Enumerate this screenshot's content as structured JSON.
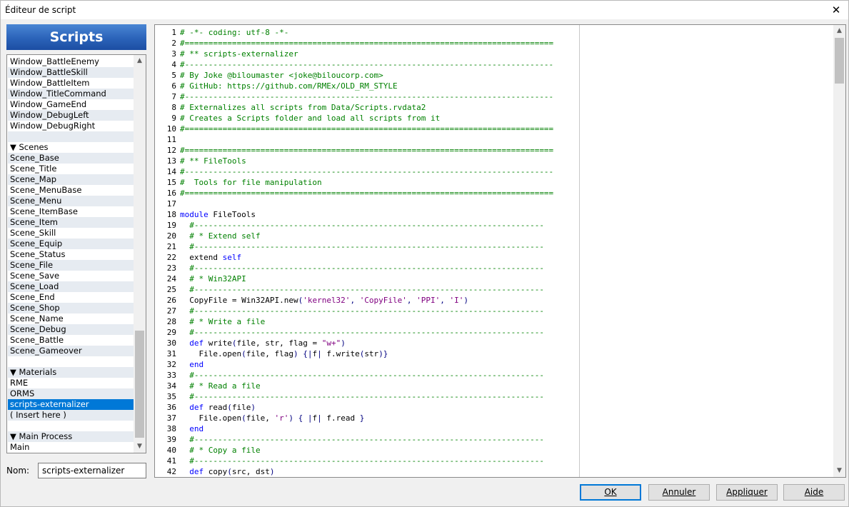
{
  "window": {
    "title": "Éditeur de script",
    "close_glyph": "✕"
  },
  "sidebar": {
    "header": "Scripts",
    "items": [
      {
        "label": "Window_BattleEnemy",
        "type": "item"
      },
      {
        "label": "Window_BattleSkill",
        "type": "item"
      },
      {
        "label": "Window_BattleItem",
        "type": "item"
      },
      {
        "label": "Window_TitleCommand",
        "type": "item"
      },
      {
        "label": "Window_GameEnd",
        "type": "item"
      },
      {
        "label": "Window_DebugLeft",
        "type": "item"
      },
      {
        "label": "Window_DebugRight",
        "type": "item"
      },
      {
        "label": "",
        "type": "blank"
      },
      {
        "label": "▼ Scenes",
        "type": "category"
      },
      {
        "label": "Scene_Base",
        "type": "item"
      },
      {
        "label": "Scene_Title",
        "type": "item"
      },
      {
        "label": "Scene_Map",
        "type": "item"
      },
      {
        "label": "Scene_MenuBase",
        "type": "item"
      },
      {
        "label": "Scene_Menu",
        "type": "item"
      },
      {
        "label": "Scene_ItemBase",
        "type": "item"
      },
      {
        "label": "Scene_Item",
        "type": "item"
      },
      {
        "label": "Scene_Skill",
        "type": "item"
      },
      {
        "label": "Scene_Equip",
        "type": "item"
      },
      {
        "label": "Scene_Status",
        "type": "item"
      },
      {
        "label": "Scene_File",
        "type": "item"
      },
      {
        "label": "Scene_Save",
        "type": "item"
      },
      {
        "label": "Scene_Load",
        "type": "item"
      },
      {
        "label": "Scene_End",
        "type": "item"
      },
      {
        "label": "Scene_Shop",
        "type": "item"
      },
      {
        "label": "Scene_Name",
        "type": "item"
      },
      {
        "label": "Scene_Debug",
        "type": "item"
      },
      {
        "label": "Scene_Battle",
        "type": "item"
      },
      {
        "label": "Scene_Gameover",
        "type": "item"
      },
      {
        "label": "",
        "type": "blank"
      },
      {
        "label": "▼ Materials",
        "type": "category"
      },
      {
        "label": "RME",
        "type": "item"
      },
      {
        "label": "ORMS",
        "type": "item"
      },
      {
        "label": "scripts-externalizer",
        "type": "item",
        "selected": true
      },
      {
        "label": "( Insert here )",
        "type": "item"
      },
      {
        "label": "",
        "type": "blank"
      },
      {
        "label": "▼ Main Process",
        "type": "category"
      },
      {
        "label": "Main",
        "type": "item"
      }
    ],
    "scroll_up": "▲",
    "scroll_down": "▼"
  },
  "name_field": {
    "label": "Nom:",
    "value": "scripts-externalizer"
  },
  "editor": {
    "scroll_up": "▲",
    "scroll_down": "▼",
    "lines": [
      {
        "n": "1",
        "t": [
          [
            "c",
            "# -*- coding: utf-8 -*-"
          ]
        ]
      },
      {
        "n": "2",
        "t": [
          [
            "c",
            "#=============================================================================="
          ]
        ]
      },
      {
        "n": "3",
        "t": [
          [
            "c",
            "# ** scripts-externalizer"
          ]
        ]
      },
      {
        "n": "4",
        "t": [
          [
            "c",
            "#------------------------------------------------------------------------------"
          ]
        ]
      },
      {
        "n": "5",
        "t": [
          [
            "c",
            "# By Joke @biloumaster <joke@biloucorp.com>"
          ]
        ]
      },
      {
        "n": "6",
        "t": [
          [
            "c",
            "# GitHub: https://github.com/RMEx/OLD_RM_STYLE"
          ]
        ]
      },
      {
        "n": "7",
        "t": [
          [
            "c",
            "#------------------------------------------------------------------------------"
          ]
        ]
      },
      {
        "n": "8",
        "t": [
          [
            "c",
            "# Externalizes all scripts from Data/Scripts.rvdata2"
          ]
        ]
      },
      {
        "n": "9",
        "t": [
          [
            "c",
            "# Creates a Scripts folder and load all scripts from it"
          ]
        ]
      },
      {
        "n": "10",
        "t": [
          [
            "c",
            "#=============================================================================="
          ]
        ]
      },
      {
        "n": "11",
        "t": []
      },
      {
        "n": "12",
        "t": [
          [
            "c",
            "#=============================================================================="
          ]
        ]
      },
      {
        "n": "13",
        "t": [
          [
            "c",
            "# ** FileTools"
          ]
        ]
      },
      {
        "n": "14",
        "t": [
          [
            "c",
            "#------------------------------------------------------------------------------"
          ]
        ]
      },
      {
        "n": "15",
        "t": [
          [
            "c",
            "#  Tools for file manipulation"
          ]
        ]
      },
      {
        "n": "16",
        "t": [
          [
            "c",
            "#=============================================================================="
          ]
        ]
      },
      {
        "n": "17",
        "t": []
      },
      {
        "n": "18",
        "t": [
          [
            "k",
            "module"
          ],
          [
            "",
            " FileTools"
          ]
        ]
      },
      {
        "n": "19",
        "t": [
          [
            "c",
            "  #--------------------------------------------------------------------------"
          ]
        ]
      },
      {
        "n": "20",
        "t": [
          [
            "c",
            "  # * Extend self"
          ]
        ]
      },
      {
        "n": "21",
        "t": [
          [
            "c",
            "  #--------------------------------------------------------------------------"
          ]
        ]
      },
      {
        "n": "22",
        "t": [
          [
            "",
            "  extend "
          ],
          [
            "k",
            "self"
          ]
        ]
      },
      {
        "n": "23",
        "t": [
          [
            "c",
            "  #--------------------------------------------------------------------------"
          ]
        ]
      },
      {
        "n": "24",
        "t": [
          [
            "c",
            "  # * Win32API"
          ]
        ]
      },
      {
        "n": "25",
        "t": [
          [
            "c",
            "  #--------------------------------------------------------------------------"
          ]
        ]
      },
      {
        "n": "26",
        "t": [
          [
            "",
            "  CopyFile = Win32API.new"
          ],
          [
            "p",
            "("
          ],
          [
            "s",
            "'kernel32'"
          ],
          [
            "p",
            ", "
          ],
          [
            "s",
            "'CopyFile'"
          ],
          [
            "p",
            ", "
          ],
          [
            "s",
            "'PPI'"
          ],
          [
            "p",
            ", "
          ],
          [
            "s",
            "'I'"
          ],
          [
            "p",
            ")"
          ]
        ]
      },
      {
        "n": "27",
        "t": [
          [
            "c",
            "  #--------------------------------------------------------------------------"
          ]
        ]
      },
      {
        "n": "28",
        "t": [
          [
            "c",
            "  # * Write a file"
          ]
        ]
      },
      {
        "n": "29",
        "t": [
          [
            "c",
            "  #--------------------------------------------------------------------------"
          ]
        ]
      },
      {
        "n": "30",
        "t": [
          [
            "",
            "  "
          ],
          [
            "k",
            "def"
          ],
          [
            "",
            " write"
          ],
          [
            "p",
            "("
          ],
          [
            "",
            "file, str, flag = "
          ],
          [
            "s",
            "\"w+\""
          ],
          [
            "p",
            ")"
          ]
        ]
      },
      {
        "n": "31",
        "t": [
          [
            "",
            "    File.open"
          ],
          [
            "p",
            "("
          ],
          [
            "",
            "file, flag"
          ],
          [
            "p",
            ") {|"
          ],
          [
            "",
            "f"
          ],
          [
            "p",
            "| "
          ],
          [
            "",
            "f.write"
          ],
          [
            "p",
            "("
          ],
          [
            "",
            "str"
          ],
          [
            "p",
            ")}"
          ]
        ]
      },
      {
        "n": "32",
        "t": [
          [
            "",
            "  "
          ],
          [
            "k",
            "end"
          ]
        ]
      },
      {
        "n": "33",
        "t": [
          [
            "c",
            "  #--------------------------------------------------------------------------"
          ]
        ]
      },
      {
        "n": "34",
        "t": [
          [
            "c",
            "  # * Read a file"
          ]
        ]
      },
      {
        "n": "35",
        "t": [
          [
            "c",
            "  #--------------------------------------------------------------------------"
          ]
        ]
      },
      {
        "n": "36",
        "t": [
          [
            "",
            "  "
          ],
          [
            "k",
            "def"
          ],
          [
            "",
            " read"
          ],
          [
            "p",
            "("
          ],
          [
            "",
            "file"
          ],
          [
            "p",
            ")"
          ]
        ]
      },
      {
        "n": "37",
        "t": [
          [
            "",
            "    File.open"
          ],
          [
            "p",
            "("
          ],
          [
            "",
            "file, "
          ],
          [
            "s",
            "'r'"
          ],
          [
            "p",
            ") { |"
          ],
          [
            "",
            "f"
          ],
          [
            "p",
            "| "
          ],
          [
            "",
            "f.read "
          ],
          [
            "p",
            "}"
          ]
        ]
      },
      {
        "n": "38",
        "t": [
          [
            "",
            "  "
          ],
          [
            "k",
            "end"
          ]
        ]
      },
      {
        "n": "39",
        "t": [
          [
            "c",
            "  #--------------------------------------------------------------------------"
          ]
        ]
      },
      {
        "n": "40",
        "t": [
          [
            "c",
            "  # * Copy a file"
          ]
        ]
      },
      {
        "n": "41",
        "t": [
          [
            "c",
            "  #--------------------------------------------------------------------------"
          ]
        ]
      },
      {
        "n": "42",
        "t": [
          [
            "",
            "  "
          ],
          [
            "k",
            "def"
          ],
          [
            "",
            " copy"
          ],
          [
            "p",
            "("
          ],
          [
            "",
            "src, dst"
          ],
          [
            "p",
            ")"
          ]
        ]
      }
    ]
  },
  "buttons": {
    "ok": "OK",
    "cancel": "Annuler",
    "apply": "Appliquer",
    "help": "Aide"
  }
}
